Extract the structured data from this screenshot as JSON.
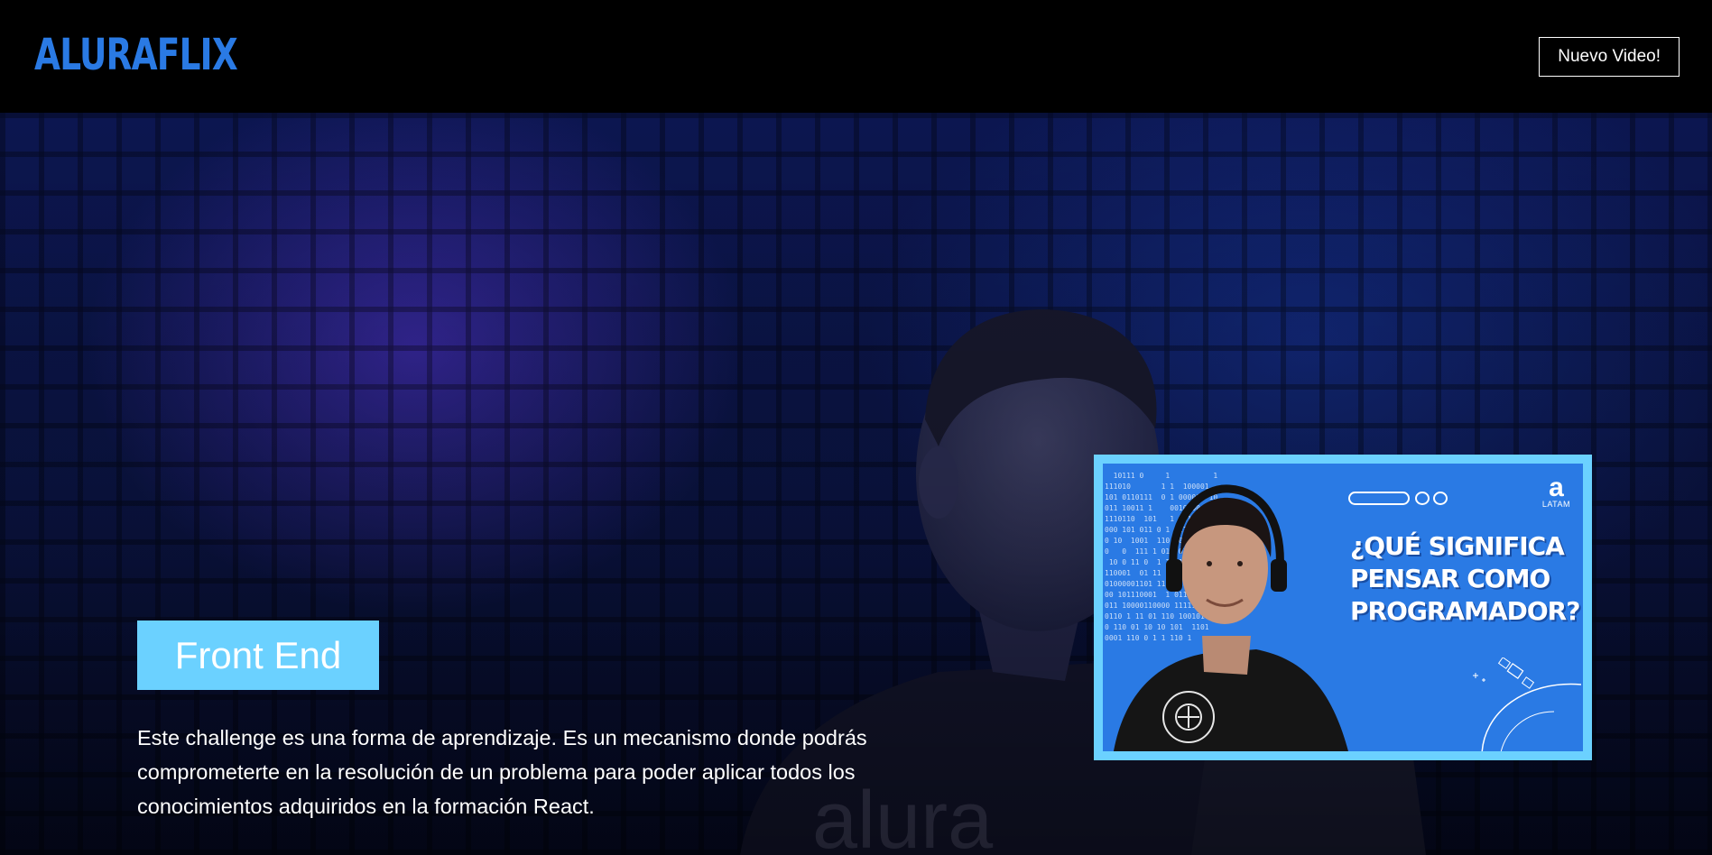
{
  "header": {
    "logo_text": "ALURAFLIX",
    "new_video_label": "Nuevo Video!"
  },
  "hero": {
    "category": "Front End",
    "description": "Este challenge es una forma de aprendizaje. Es un mecanismo donde podrás comprometerte en la resolución de un problema para poder aplicar todos los conocimientos adquiridos en la formación React.",
    "video_card": {
      "title_lines": [
        "¿QUÉ SIGNIFICA",
        "PENSAR COMO",
        "PROGRAMADOR?"
      ],
      "brand_mark": "a",
      "brand_sub": "LATAM",
      "binary_text": "  10111 0     1          1\n111010       1 1  100001\n101 0110111  0 1 000000 10\n011 10011 1    0010100 1\n1110110  101   1 10100 0\n000 101 011 0 1 0110000 0\n0 10  1001  110 10001011\n0   0  111 1 010 0110 1\n 10 0 11 0  1 101100011 0\n110001  01 11 1 0101110 1\n01000001101 111 11000 0001\n00 101110001  1 011 100 110 0\n011 10000110000 111111100110\n0110 1 11 01 110 1001010 0110\n0 110 01 10 10 101  1101\n0001 110 0 1 1 110 1"
    },
    "colors": {
      "accent_blue": "#2a7ae4",
      "frontend_light_blue": "#6bd1ff",
      "header_background": "#000000"
    }
  }
}
